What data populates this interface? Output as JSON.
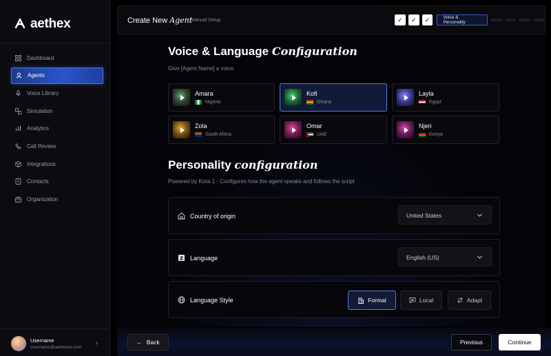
{
  "brand": {
    "name": "aethex"
  },
  "sidebar": {
    "items": [
      {
        "label": "Dashboard",
        "icon": "grid-icon",
        "active": false
      },
      {
        "label": "Agents",
        "icon": "user-icon",
        "active": true
      },
      {
        "label": "Voice Library",
        "icon": "microphone-icon",
        "active": false
      },
      {
        "label": "Simulation",
        "icon": "simulation-icon",
        "active": false
      },
      {
        "label": "Analytics",
        "icon": "bar-chart-icon",
        "active": false
      },
      {
        "label": "Call Review",
        "icon": "phone-icon",
        "active": false
      },
      {
        "label": "Integrations",
        "icon": "cube-icon",
        "active": false
      },
      {
        "label": "Contacts",
        "icon": "contacts-icon",
        "active": false
      },
      {
        "label": "Organization",
        "icon": "briefcase-icon",
        "active": false
      }
    ],
    "user": {
      "name": "Username",
      "email": "username@aethexai.com"
    }
  },
  "header": {
    "title": "Create New",
    "title_italic": "Agent",
    "subtitle": "- Manual Setup",
    "current_step": "Voice & Personality",
    "completed_steps": 3,
    "pending_steps": 4
  },
  "voice_section": {
    "title": "Voice & Language",
    "title_italic": "Configuration",
    "subtitle": "Give [Agent Name] a voice",
    "voices": [
      {
        "name": "Amara",
        "country": "Nigeria",
        "selected": false
      },
      {
        "name": "Kofi",
        "country": "Ghana",
        "selected": true
      },
      {
        "name": "Layla",
        "country": "Egypt",
        "selected": false
      },
      {
        "name": "Zola",
        "country": "South Africa",
        "selected": false
      },
      {
        "name": "Omar",
        "country": "UAE",
        "selected": false
      },
      {
        "name": "Njeri",
        "country": "Kenya",
        "selected": false
      }
    ]
  },
  "personality_section": {
    "title": "Personality",
    "title_italic": "configuration",
    "subtitle": "Powered by Kora 1 - Configures how the agent speaks and follows the script",
    "country": {
      "label": "Country of origin",
      "value": "United States"
    },
    "language": {
      "label": "Language",
      "value": "English (US)"
    },
    "language_style": {
      "label": "Language Style",
      "options": [
        "Formal",
        "Local",
        "Adapt"
      ],
      "selected": "Formal"
    }
  },
  "footer": {
    "back_label": "Back",
    "previous_label": "Previous",
    "continue_label": "Continue"
  },
  "colors": {
    "accent": "#4f78e6",
    "background": "#000000",
    "panel": "#07070b"
  }
}
